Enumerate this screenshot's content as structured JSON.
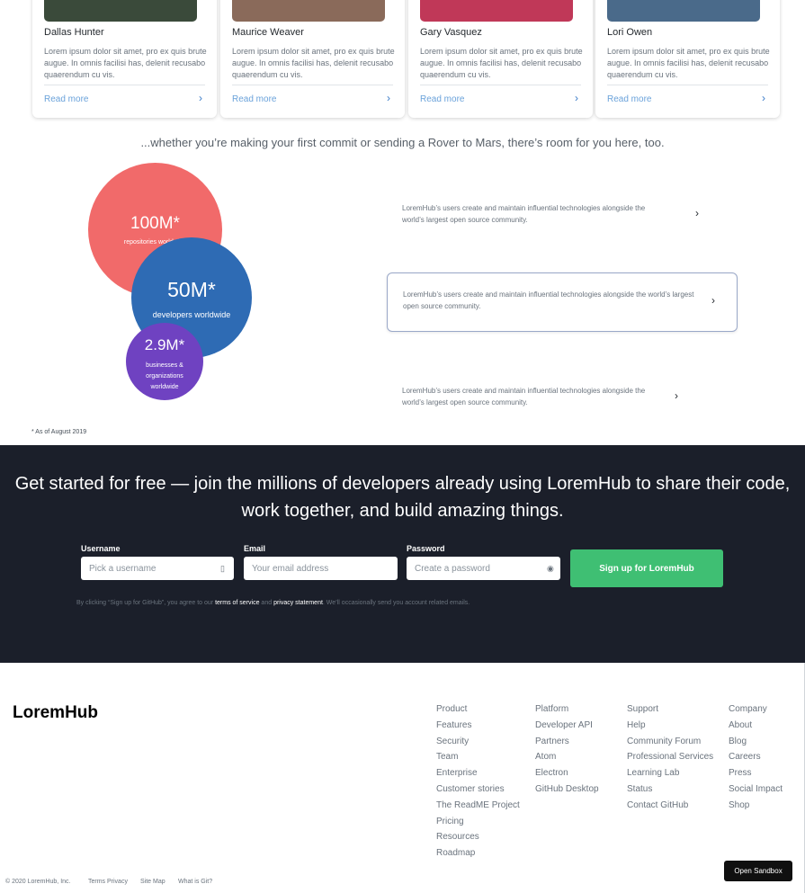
{
  "team": [
    {
      "name": "Dallas Hunter",
      "bio": "Lorem ipsum dolor sit amet, pro ex quis brute augue. In omnis facilisi has, delenit recusabo quaerendum cu vis.",
      "link": "Read more",
      "photo_color": "#3a4a3a"
    },
    {
      "name": "Maurice Weaver",
      "bio": "Lorem ipsum dolor sit amet, pro ex quis brute augue. In omnis facilisi has, delenit recusabo quaerendum cu vis.",
      "link": "Read more",
      "photo_color": "#8a6a5a"
    },
    {
      "name": "Gary Vasquez",
      "bio": "Lorem ipsum dolor sit amet, pro ex quis brute augue. In omnis facilisi has, delenit recusabo quaerendum cu vis.",
      "link": "Read more",
      "photo_color": "#c03858"
    },
    {
      "name": "Lori Owen",
      "bio": "Lorem ipsum dolor sit amet, pro ex quis brute augue. In omnis facilisi has, delenit recusabo quaerendum cu vis.",
      "link": "Read more",
      "photo_color": "#4a6a8a"
    }
  ],
  "tagline": "...whether you’re making your first commit or sending a Rover to Mars, there’s room for you here, too.",
  "stats": [
    {
      "value": "100M*",
      "label": "repositories worldwide",
      "color": "#f16a6a"
    },
    {
      "value": "50M*",
      "label": "developers worldwide",
      "color": "#2e6bb4"
    },
    {
      "value": "2.9M*",
      "label": "businesses & organizations worldwide",
      "color": "#6f42c1"
    }
  ],
  "footnote": "* As of August 2019",
  "features": [
    "LoremHub’s users create and maintain influential technologies alongside the world’s largest open source community.",
    "LoremHub’s users create and maintain influential technologies alongside the world’s largest open source community.",
    "LoremHub’s users create and maintain influential technologies alongside the world’s largest open source community."
  ],
  "signup": {
    "headline": "Get started for free — join the millions of developers already using LoremHub to share their code, work together, and build amazing things.",
    "username_label": "Username",
    "username_placeholder": "Pick a username",
    "email_label": "Email",
    "email_placeholder": "Your email address",
    "password_label": "Password",
    "password_placeholder": "Create a password",
    "button": "Sign up for LoremHub",
    "legal_prefix": "By clicking “Sign up for GitHub”, you agree to our ",
    "terms": "terms of service",
    "and": " and ",
    "privacy": "privacy statement",
    "legal_suffix": ". We’ll occasionally send you account related emails."
  },
  "footer": {
    "logo": "LoremHub",
    "columns": [
      [
        "Product",
        "Features",
        "Security",
        "Team",
        "Enterprise",
        "Customer stories",
        "The ReadME Project",
        "Pricing",
        "Resources",
        "Roadmap"
      ],
      [
        "Platform",
        "Developer API",
        "Partners",
        "Atom",
        "Electron",
        "GitHub Desktop"
      ],
      [
        "Support",
        "Help",
        "Community Forum",
        "Professional Services",
        "Learning Lab",
        "Status",
        "Contact GitHub"
      ],
      [
        "Company",
        "About",
        "Blog",
        "Careers",
        "Press",
        "Social Impact",
        "Shop"
      ]
    ],
    "copyright": "© 2020 LoremHub, Inc.",
    "bottom_links": [
      "Terms Privacy",
      "Site Map",
      "What is Git?"
    ],
    "sandbox_button": "Open Sandbox"
  }
}
